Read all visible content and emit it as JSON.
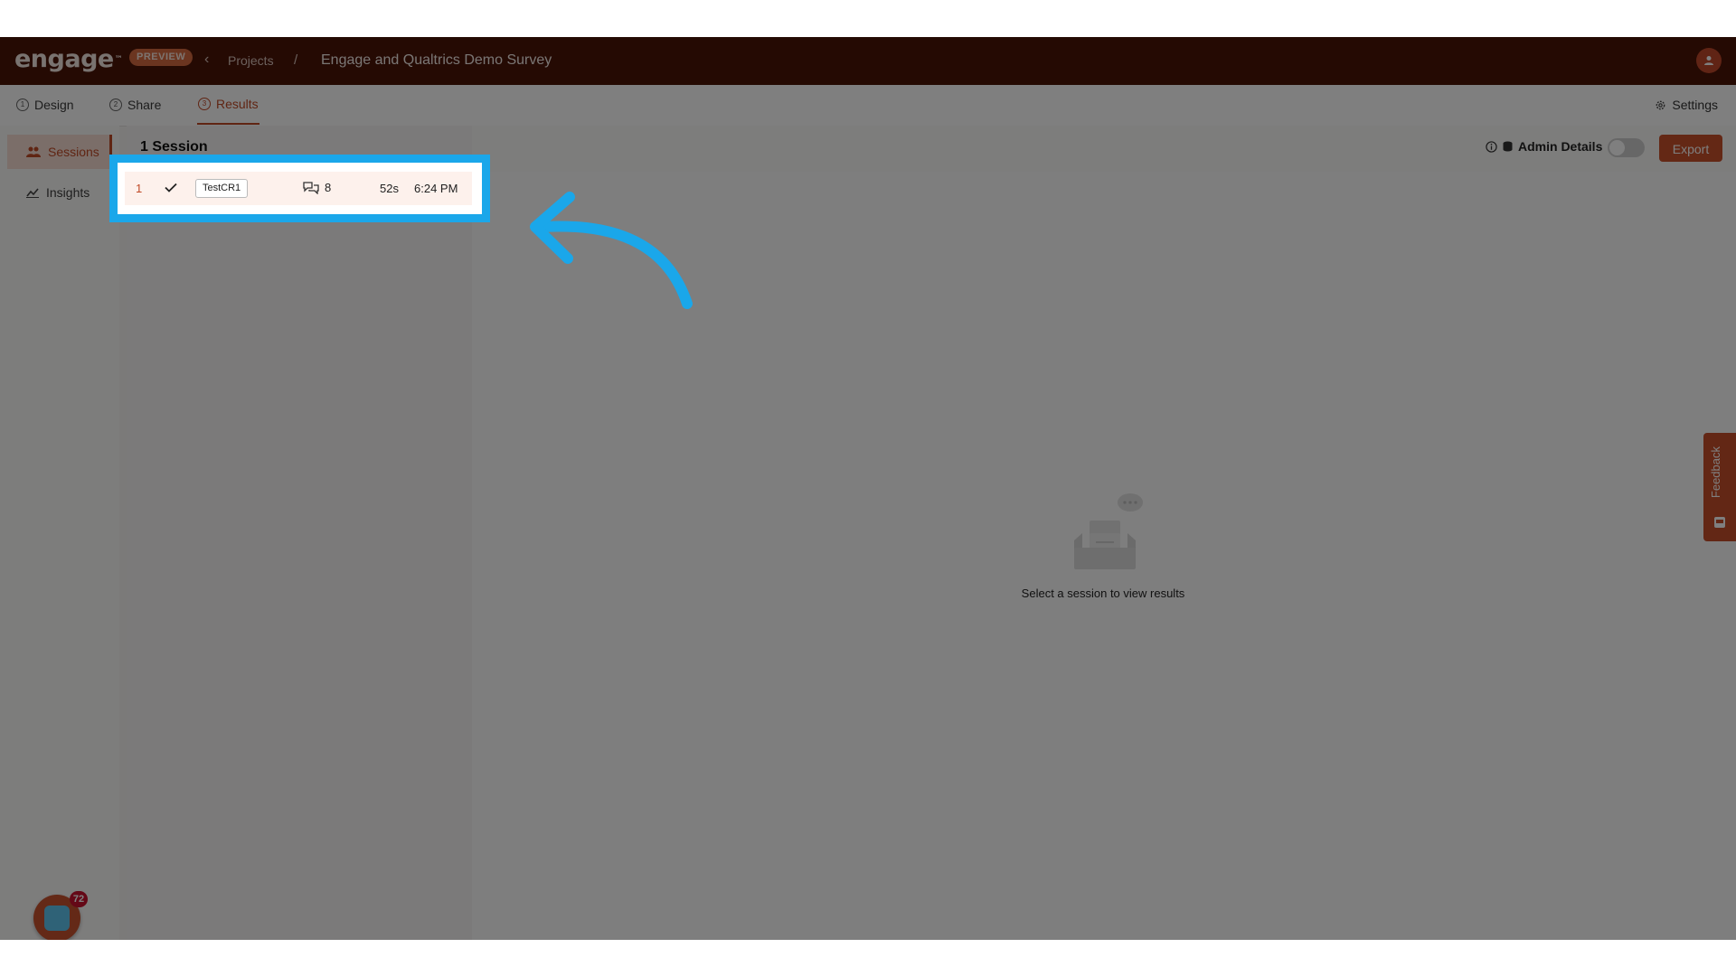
{
  "app": {
    "logo_text": "engage",
    "logo_tm": "™",
    "preview_badge": "PREVIEW"
  },
  "breadcrumb": {
    "projects": "Projects",
    "separator": "/",
    "title": "Engage and Qualtrics Demo Survey"
  },
  "tabs": [
    {
      "number": "1",
      "label": "Design"
    },
    {
      "number": "2",
      "label": "Share"
    },
    {
      "number": "3",
      "label": "Results"
    }
  ],
  "settings_label": "Settings",
  "sidebar": {
    "items": [
      {
        "label": "Sessions",
        "icon": "users-icon"
      },
      {
        "label": "Insights",
        "icon": "chart-icon"
      }
    ]
  },
  "launcher": {
    "badge": "72"
  },
  "sessions": {
    "title": "1 Session",
    "rows": [
      {
        "index": "1",
        "name": "TestCR1",
        "messages": "8",
        "duration": "52s",
        "time": "6:24 PM"
      }
    ]
  },
  "toolbar": {
    "admin_label": "Admin Details",
    "export_label": "Export"
  },
  "empty_state": {
    "text": "Select a session to view results"
  },
  "feedback_label": "Feedback",
  "colors": {
    "topbar": "#4a1406",
    "accent": "#c04a27",
    "highlight": "#1aa7ea"
  }
}
